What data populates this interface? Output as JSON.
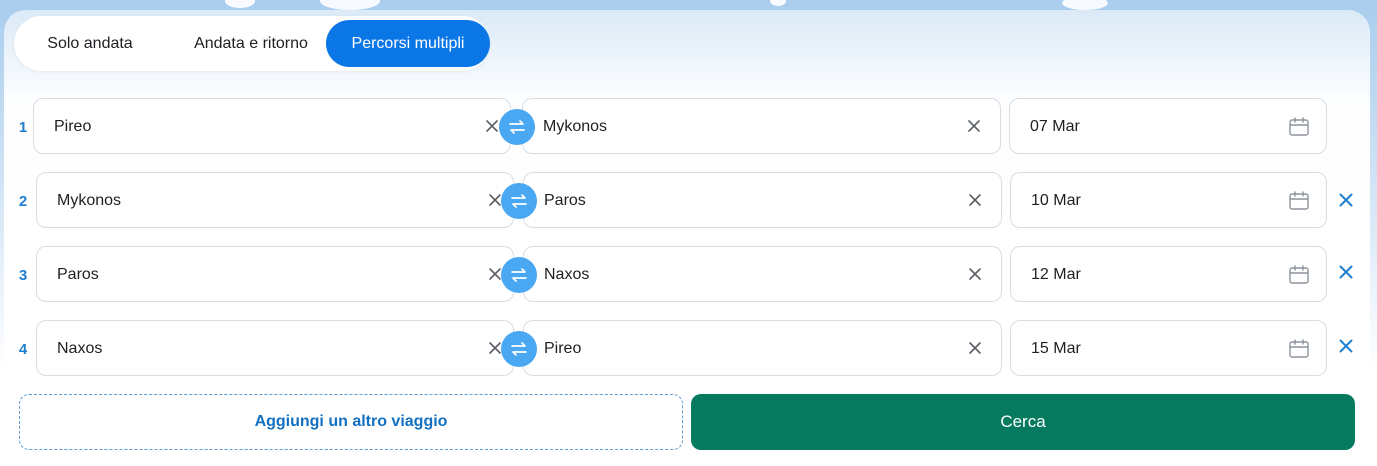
{
  "tabs": [
    {
      "label": "Solo andata",
      "active": false
    },
    {
      "label": "Andata e ritorno",
      "active": false
    },
    {
      "label": "Percorsi multipli",
      "active": true
    }
  ],
  "trips": [
    {
      "number": "1",
      "from": "Pireo",
      "to": "Mykonos",
      "date": "07 Mar",
      "removable": false
    },
    {
      "number": "2",
      "from": "Mykonos",
      "to": "Paros",
      "date": "10 Mar",
      "removable": true
    },
    {
      "number": "3",
      "from": "Paros",
      "to": "Naxos",
      "date": "12 Mar",
      "removable": true
    },
    {
      "number": "4",
      "from": "Naxos",
      "to": "Pireo",
      "date": "15 Mar",
      "removable": true
    }
  ],
  "actions": {
    "add_trip_label": "Aggiungi un altro viaggio",
    "search_label": "Cerca"
  },
  "icons": {
    "clear": "close-icon",
    "swap": "swap-arrows-icon",
    "calendar": "calendar-icon",
    "remove": "remove-trip-icon"
  },
  "colors": {
    "accent": "#0b77e6",
    "swap_button": "#4aa7f2",
    "row_number": "#1f7fd0",
    "search_button": "#057a5f",
    "add_trip_text": "#1370c2"
  }
}
